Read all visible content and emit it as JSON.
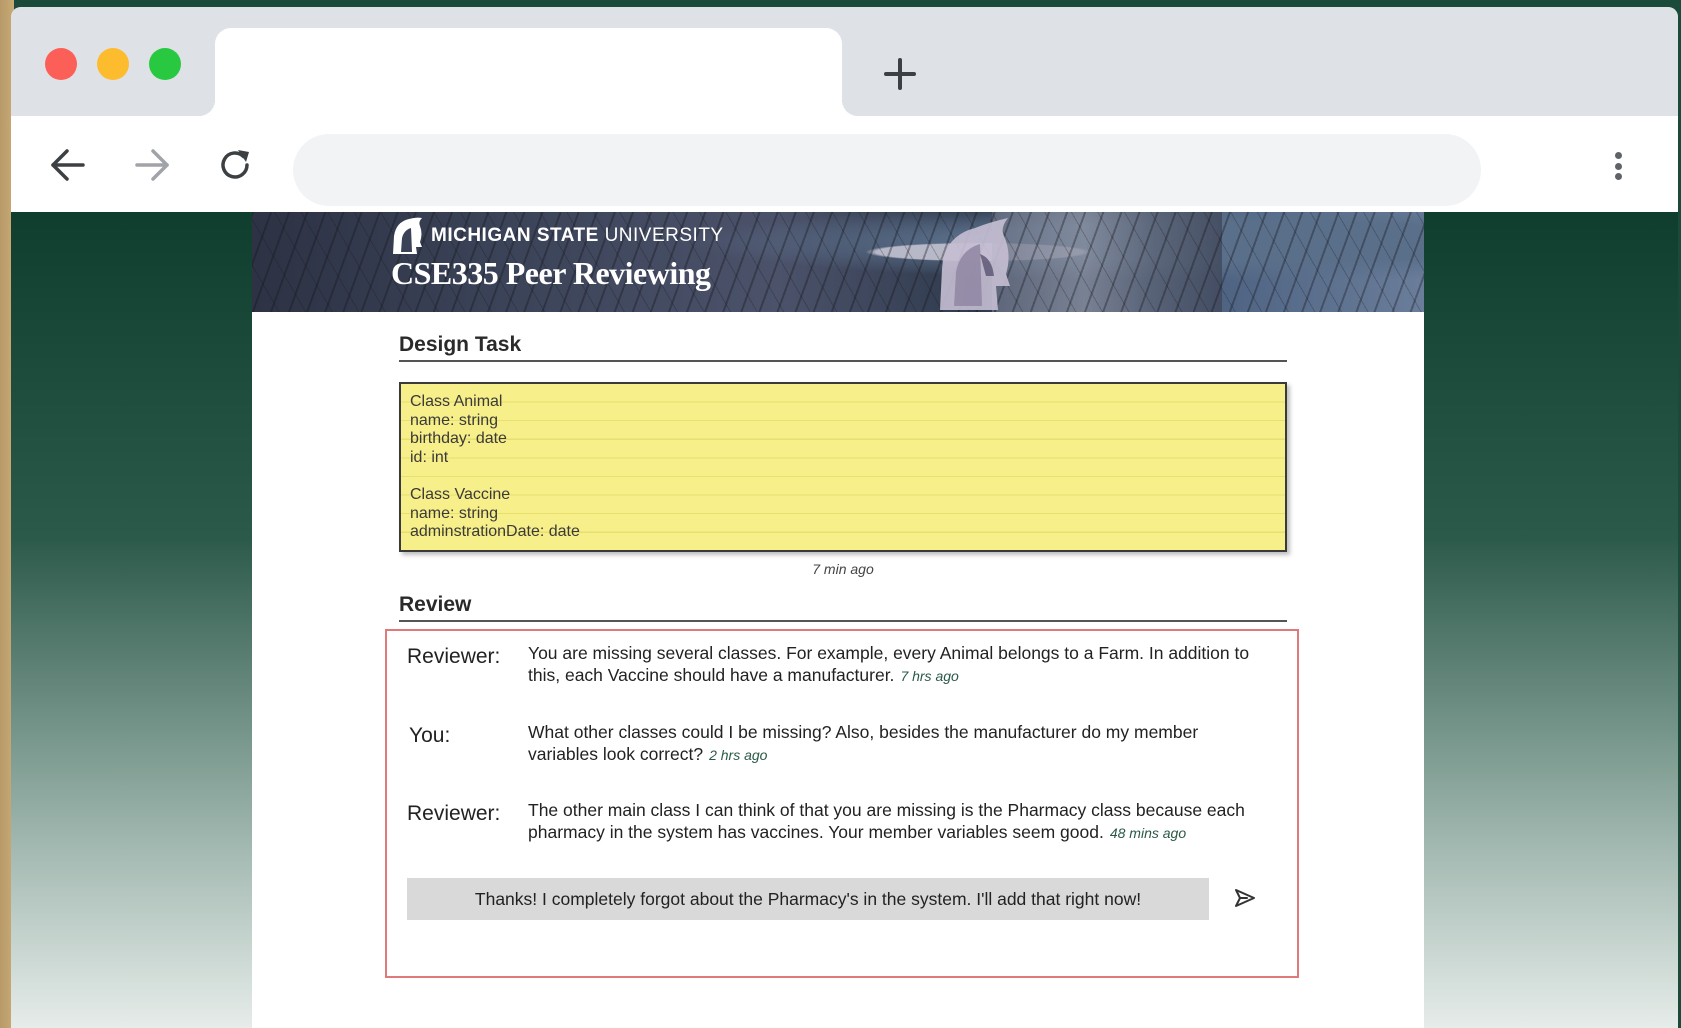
{
  "browser": {
    "tab_title": "",
    "new_tab_icon": "plus-icon",
    "address": "",
    "nav_icons": [
      "arrow-left-icon",
      "arrow-right-icon",
      "reload-icon",
      "more-vertical-icon"
    ]
  },
  "banner": {
    "university_bold": "MICHIGAN STATE",
    "university_light": " UNIVERSITY",
    "course_title": "CSE335 Peer Reviewing"
  },
  "design": {
    "heading": "Design Task",
    "class1": {
      "title": "Class Animal",
      "fields": [
        "name: string",
        "birthday: date",
        "id: int"
      ]
    },
    "class2": {
      "title": "Class Vaccine",
      "fields": [
        "name: string",
        "adminstrationDate: date"
      ]
    },
    "timestamp": "7 min ago"
  },
  "review": {
    "heading": "Review",
    "messages": [
      {
        "author": "Reviewer:",
        "text": "You are missing several classes. For example, every Animal belongs to a Farm. In addition to this, each Vaccine should have a manufacturer.",
        "time": "7 hrs ago"
      },
      {
        "author": "You:",
        "text": "What other classes could I be missing? Also, besides the manufacturer do my member variables look correct?",
        "time": "2 hrs ago"
      },
      {
        "author": "Reviewer:",
        "text": "The other main class I can think of that you are missing is the Pharmacy class because each pharmacy in the system has vaccines. Your member variables seem good.",
        "time": "48 mins ago"
      }
    ],
    "reply_value": "Thanks! I completely forgot about the Pharmacy's in the system. I'll add that right now!",
    "send_icon": "send-icon"
  },
  "colors": {
    "background_green": "#0f3d2e",
    "sticky_yellow": "#f7ef8a",
    "review_border": "#e07a7a",
    "timestamp_green": "#2a5a46"
  }
}
